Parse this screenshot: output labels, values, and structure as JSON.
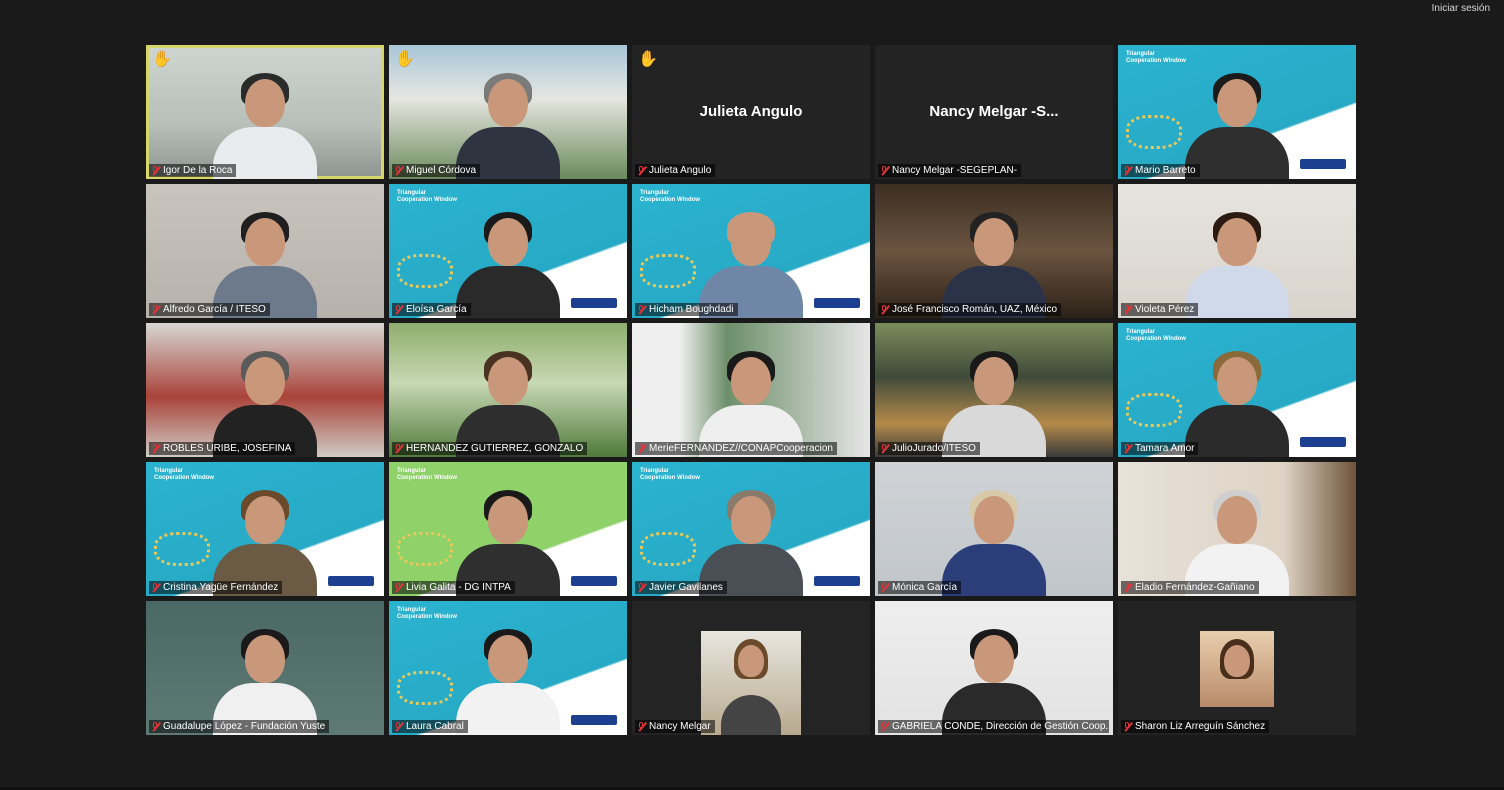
{
  "topbar": {
    "signin_label": "Iniciar sesión"
  },
  "slide": {
    "title_text": "Triangular Cooperation Window"
  },
  "participants": [
    {
      "name": "Igor De la Roca",
      "hand": true,
      "active": true,
      "bg": "office",
      "hair": "#2b2b2b",
      "torso": "#e9ecef"
    },
    {
      "name": "Miguel Córdova",
      "hand": true,
      "bg": "building",
      "hair": "#7a7a78",
      "torso": "#2e3440"
    },
    {
      "name": "Julieta Angulo",
      "hand": true,
      "label": "Julieta Angulo",
      "bg": "dark"
    },
    {
      "name": "Nancy Melgar -SEGEPLAN-",
      "label": "Nancy Melgar -S...",
      "bg": "dark"
    },
    {
      "name": "Mario Barreto",
      "bg": "slide",
      "hair": "#1b1b1b",
      "torso": "#2f2f2f"
    },
    {
      "name": "Alfredo García / ITESO",
      "bg": "iteso",
      "hair": "#1f1f1f",
      "torso": "#6d7a8c"
    },
    {
      "name": "Eloísa García",
      "bg": "slide",
      "hair": "#1a1a1a",
      "torso": "#2a2a2a"
    },
    {
      "name": "Hicham Boughdadi",
      "bg": "slide",
      "hair": "#c9987a",
      "torso": "#6f86a6"
    },
    {
      "name": "José Francisco Román, UAZ, México",
      "bg": "books",
      "hair": "#222",
      "torso": "#2b3349"
    },
    {
      "name": "Violeta Pérez",
      "bg": "room",
      "hair": "#2b1a12",
      "torso": "#cfd9ea"
    },
    {
      "name": "ROBLES URIBE, JOSEFINA",
      "bg": "church",
      "hair": "#5a5a5a",
      "torso": "#222"
    },
    {
      "name": "HERNANDEZ GUTIERREZ, GONZALO",
      "bg": "park",
      "hair": "#4a3222",
      "torso": "#2e2e2e"
    },
    {
      "name": "MerieFERNANDEZ//CONAPCooperacion",
      "bg": "waterfall",
      "hair": "#1a1a1a",
      "torso": "#efefef"
    },
    {
      "name": "JulioJurado/ITESO",
      "bg": "night",
      "hair": "#1a1a1a",
      "torso": "#d9d9d9"
    },
    {
      "name": "Tamara Amor",
      "bg": "slide",
      "hair": "#8a6a3a",
      "torso": "#2b2b2b"
    },
    {
      "name": "Cristina Yagüe Fernández",
      "bg": "slide",
      "hair": "#6a4a2a",
      "torso": "#6b5a44"
    },
    {
      "name": "Livia Galita - DG INTPA",
      "bg": "slide-green",
      "hair": "#1a1a1a",
      "torso": "#2f2f2f"
    },
    {
      "name": "Javier Gavilanes",
      "bg": "slide",
      "hair": "#8a7a6a",
      "torso": "#4a4f55"
    },
    {
      "name": "Mónica García",
      "bg": "wall",
      "hair": "#d8c9a8",
      "torso": "#2c3e7a"
    },
    {
      "name": "Eladio Fernández-Gañiano",
      "bg": "shelf",
      "hair": "#cfcfcf",
      "torso": "#f2f2f2"
    },
    {
      "name": "Guadalupe López - Fundación Yuste",
      "bg": "teal",
      "hair": "#1a1a1a",
      "torso": "#f0f0f0"
    },
    {
      "name": "Laura Cabral",
      "bg": "slide",
      "hair": "#1a1a1a",
      "torso": "#f2f2f2"
    },
    {
      "name": "Nancy Melgar",
      "bg": "lab",
      "thumb": true,
      "hair": "#6a4a2a",
      "torso": "#444"
    },
    {
      "name": "GABRIELA CONDE, Dirección de Gestión Coop...",
      "bg": "white",
      "hair": "#1a1a1a",
      "torso": "#2a2a2a"
    },
    {
      "name": "Sharon Liz Arreguín Sánchez",
      "bg": "dark",
      "avatar": true
    }
  ]
}
